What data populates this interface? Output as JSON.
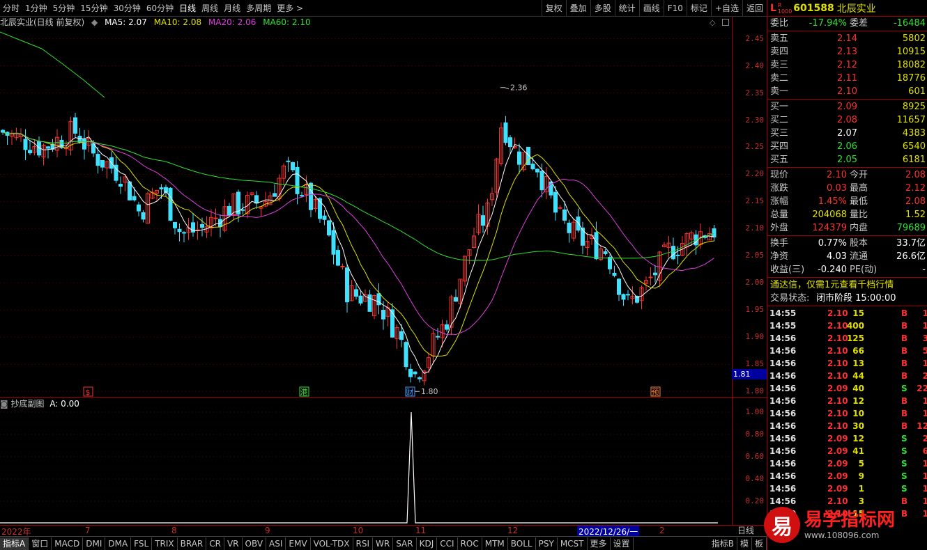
{
  "toolbar": {
    "periods": [
      "分时",
      "1分钟",
      "5分钟",
      "15分钟",
      "30分钟",
      "60分钟",
      "日线",
      "周线",
      "月线",
      "多周期",
      "更多 >"
    ],
    "active_index": 6,
    "right_buttons": [
      "复权",
      "叠加",
      "多股",
      "统计",
      "画线",
      "F10",
      "标记",
      "+自选",
      "返回"
    ]
  },
  "chart_header": {
    "name": "北辰实业(日线 前复权)",
    "ma5": "MA5: 2.07",
    "ma10": "MA10: 2.08",
    "ma20": "MA20: 2.06",
    "ma60": "MA60: 2.10",
    "ma5_color": "#ffffff",
    "ma10_color": "#e0e000",
    "ma20_color": "#e040e0",
    "ma60_color": "#30e030"
  },
  "price_axis": [
    "2.45",
    "2.40",
    "2.35",
    "2.30",
    "2.25",
    "2.20",
    "2.15",
    "2.10",
    "2.05",
    "2.00",
    "1.95",
    "1.90",
    "1.85",
    "1.80"
  ],
  "current_price_tag": "1.81",
  "annotations": {
    "high": "2.36",
    "low": "1.80"
  },
  "event_markers": [
    {
      "label": "$",
      "color": "#ff3030"
    },
    {
      "label": "港",
      "color": "#30e030"
    },
    {
      "label": "财",
      "color": "#40a0ff"
    },
    {
      "label": "预",
      "color": "#ff8030"
    }
  ],
  "sub_chart": {
    "title": "抄底副图",
    "value": "A: 0.00",
    "axis": [
      "1.00",
      "0.80",
      "0.60",
      "0.40",
      "0.20"
    ]
  },
  "date_axis": [
    "2022年",
    "7",
    "8",
    "9",
    "10",
    "11",
    "12",
    "2022/12/26/一",
    "2"
  ],
  "date_period_button": "日线",
  "bottom_tabs": [
    "指标A",
    "窗口",
    "MACD",
    "DMI",
    "DMA",
    "FSL",
    "TRIX",
    "BRAR",
    "CR",
    "VR",
    "OBV",
    "ASI",
    "EMV",
    "VOL-TDX",
    "RSI",
    "WR",
    "SAR",
    "KDJ",
    "CCI",
    "ROC",
    "MTM",
    "BOLL",
    "PSY",
    "MCST",
    "更多",
    "设置"
  ],
  "bottom_right": [
    "指标B",
    "模",
    "板"
  ],
  "stock": {
    "code": "601588",
    "name": "北辰实业",
    "badge_l": "L",
    "badge_r": "R",
    "badge_num": "1000"
  },
  "weibi": {
    "label1": "委比",
    "value1": "-17.94%",
    "label2": "委差",
    "value2": "-16484"
  },
  "sells": [
    {
      "label": "卖五",
      "price": "2.14",
      "vol": "5802"
    },
    {
      "label": "卖四",
      "price": "2.13",
      "vol": "10915"
    },
    {
      "label": "卖三",
      "price": "2.12",
      "vol": "18082"
    },
    {
      "label": "卖二",
      "price": "2.11",
      "vol": "18776"
    },
    {
      "label": "卖一",
      "price": "2.10",
      "vol": "601"
    }
  ],
  "buys": [
    {
      "label": "买一",
      "price": "2.09",
      "vol": "8925",
      "color": "red"
    },
    {
      "label": "买二",
      "price": "2.08",
      "vol": "11657",
      "color": "red"
    },
    {
      "label": "买三",
      "price": "2.07",
      "vol": "4383",
      "color": "white"
    },
    {
      "label": "买四",
      "price": "2.06",
      "vol": "6540",
      "color": "green"
    },
    {
      "label": "买五",
      "price": "2.05",
      "vol": "6181",
      "color": "green"
    }
  ],
  "quote": [
    {
      "l1": "现价",
      "v1": "2.10",
      "l2": "今开",
      "v2": "2.08",
      "c1": "red",
      "c2": "red"
    },
    {
      "l1": "涨跌",
      "v1": "0.03",
      "l2": "最高",
      "v2": "2.12",
      "c1": "red",
      "c2": "red"
    },
    {
      "l1": "涨幅",
      "v1": "1.45%",
      "l2": "最低",
      "v2": "2.08",
      "c1": "red",
      "c2": "red"
    },
    {
      "l1": "总量",
      "v1": "204068",
      "l2": "量比",
      "v2": "1.52",
      "c1": "yellow",
      "c2": "yellow"
    },
    {
      "l1": "外盘",
      "v1": "124379",
      "l2": "内盘",
      "v2": "79689",
      "c1": "red",
      "c2": "green"
    }
  ],
  "fund": [
    {
      "l1": "换手",
      "v1": "0.77%",
      "l2": "股本",
      "v2": "33.7亿"
    },
    {
      "l1": "净资",
      "v1": "4.03",
      "l2": "流通",
      "v2": "26.6亿"
    },
    {
      "l1": "收益(三)",
      "v1": "-0.240",
      "l2": "PE(动)",
      "v2": "-"
    }
  ],
  "promo": "通达信，仅需1元查看千档行情",
  "trade_status_label": "交易状态:",
  "trade_status_value": "闭市阶段 15:00:00",
  "ticks": [
    {
      "t": "14:55",
      "p": "2.10",
      "v": "15",
      "s": "B",
      "n": "1",
      "pc": "red"
    },
    {
      "t": "14:55",
      "p": "2.10",
      "v": "400",
      "s": "B",
      "n": "1",
      "pc": "red"
    },
    {
      "t": "14:56",
      "p": "2.10",
      "v": "125",
      "s": "B",
      "n": "3",
      "pc": "red"
    },
    {
      "t": "14:56",
      "p": "2.10",
      "v": "66",
      "s": "B",
      "n": "5",
      "pc": "red"
    },
    {
      "t": "14:56",
      "p": "2.10",
      "v": "13",
      "s": "B",
      "n": "1",
      "pc": "red"
    },
    {
      "t": "14:56",
      "p": "2.10",
      "v": "44",
      "s": "B",
      "n": "2",
      "pc": "red"
    },
    {
      "t": "14:56",
      "p": "2.09",
      "v": "40",
      "s": "S",
      "n": "22",
      "pc": "red"
    },
    {
      "t": "14:56",
      "p": "2.10",
      "v": "12",
      "s": "B",
      "n": "1",
      "pc": "red"
    },
    {
      "t": "14:56",
      "p": "2.10",
      "v": "10",
      "s": "B",
      "n": "1",
      "pc": "red"
    },
    {
      "t": "14:56",
      "p": "2.10",
      "v": "30",
      "s": "B",
      "n": "12",
      "pc": "red"
    },
    {
      "t": "14:56",
      "p": "2.09",
      "v": "12",
      "s": "S",
      "n": "2",
      "pc": "red"
    },
    {
      "t": "14:56",
      "p": "2.09",
      "v": "41",
      "s": "S",
      "n": "6",
      "pc": "red"
    },
    {
      "t": "14:56",
      "p": "2.09",
      "v": "5",
      "s": "S",
      "n": "1",
      "pc": "red"
    },
    {
      "t": "14:56",
      "p": "2.09",
      "v": "9",
      "s": "S",
      "n": "1",
      "pc": "red"
    },
    {
      "t": "14:56",
      "p": "2.09",
      "v": "1",
      "s": "S",
      "n": "1",
      "pc": "red"
    },
    {
      "t": "14:56",
      "p": "2.10",
      "v": "3",
      "s": "B",
      "n": "1",
      "pc": "red"
    },
    {
      "t": "15:00",
      "p": "2.10",
      "v": "15",
      "s": "B",
      "n": "1",
      "pc": "red"
    }
  ],
  "watermark": {
    "logo_char": "易",
    "title": "易学指标网",
    "url": "www.108096.com"
  }
}
